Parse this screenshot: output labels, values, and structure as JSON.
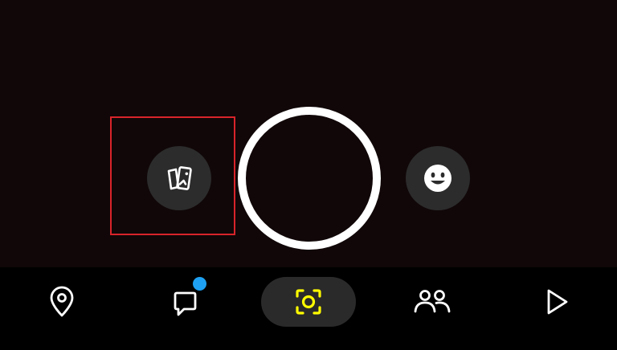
{
  "app": {
    "screen": "camera"
  },
  "colors": {
    "background": "#110708",
    "nav_background": "#000000",
    "icon": "#ffffff",
    "camera_active": "#fffc00",
    "badge": "#1ea1f2",
    "highlight_box": "#d8242a"
  },
  "camera_controls": {
    "memories_icon": "memories-cards-icon",
    "shutter": "capture-circle",
    "lenses_icon": "smiley-face-icon"
  },
  "bottom_nav": {
    "items": [
      {
        "id": "map",
        "icon": "location-pin-icon",
        "active": false
      },
      {
        "id": "chat",
        "icon": "chat-bubble-icon",
        "active": false,
        "has_notification": true
      },
      {
        "id": "camera",
        "icon": "camera-scan-icon",
        "active": true
      },
      {
        "id": "stories",
        "icon": "friends-icon",
        "active": false
      },
      {
        "id": "spotlight",
        "icon": "play-icon",
        "active": false
      }
    ]
  }
}
